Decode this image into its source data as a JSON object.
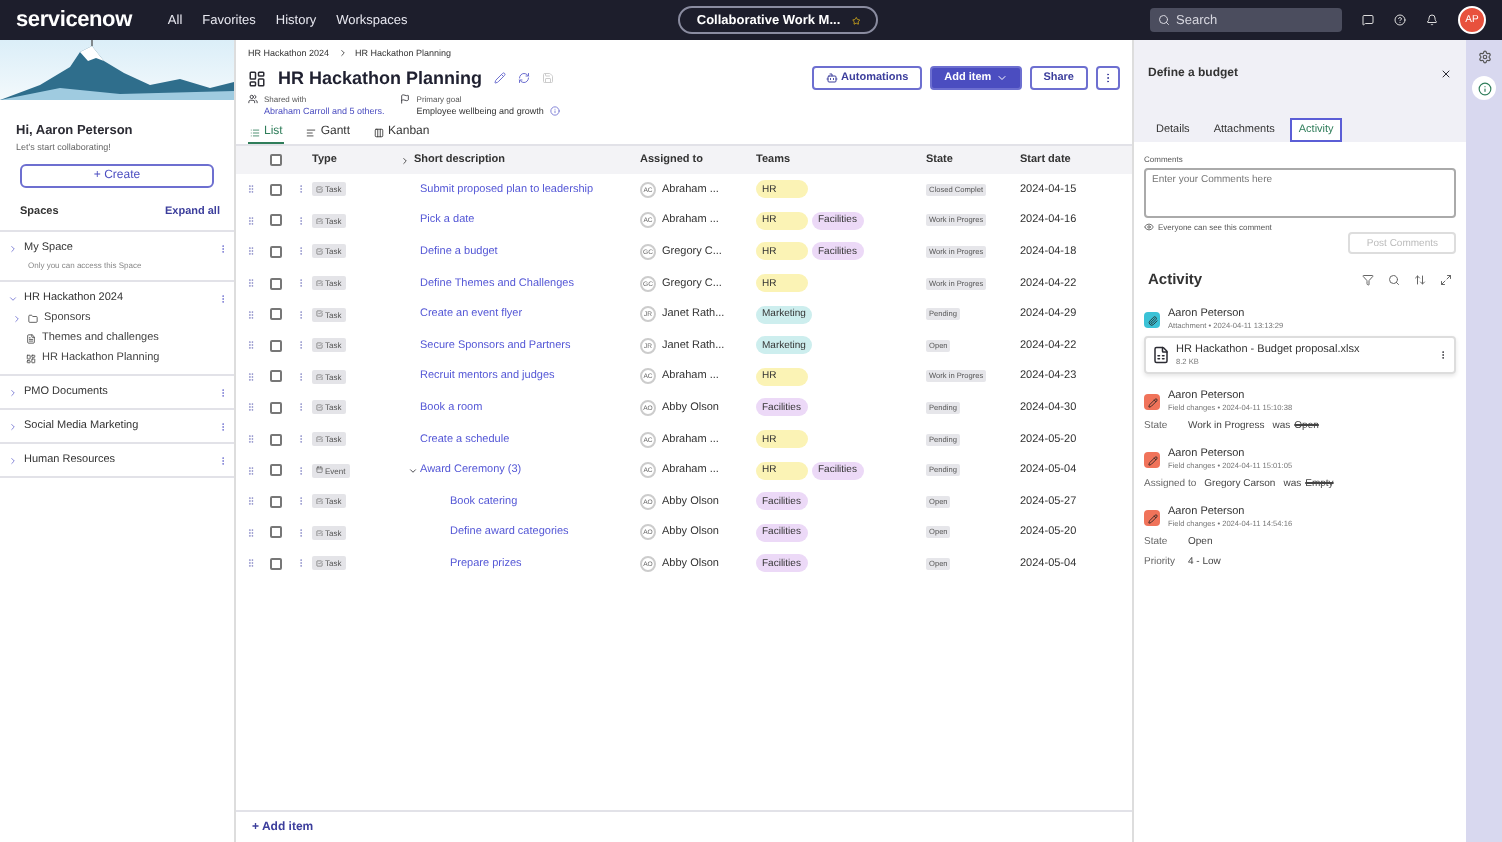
{
  "top_nav": {
    "logo": "servicenow",
    "menu": [
      "All",
      "Favorites",
      "History",
      "Workspaces"
    ],
    "workspace_pill": {
      "label": "Collaborative Work M...",
      "starred": false
    },
    "search": {
      "placeholder": "Search"
    },
    "avatar": "AP"
  },
  "sidebar": {
    "greeting": "Hi, Aaron Peterson",
    "subtitle": "Let's start collaborating!",
    "create_button": "+ Create",
    "spaces_label": "Spaces",
    "expand_all": "Expand all",
    "spaces": [
      {
        "name": "My Space",
        "note": "Only you can access this Space",
        "expanded": false
      },
      {
        "name": "HR Hackathon 2024",
        "expanded": true,
        "children": [
          {
            "kind": "folder",
            "label": "Sponsors"
          },
          {
            "kind": "document",
            "label": "Themes and challenges"
          },
          {
            "kind": "board",
            "label": "HR Hackathon Planning"
          }
        ]
      },
      {
        "name": "PMO Documents",
        "expanded": false
      },
      {
        "name": "Social Media Marketing",
        "expanded": false
      },
      {
        "name": "Human Resources",
        "expanded": false
      }
    ]
  },
  "main": {
    "breadcrumb": [
      "HR Hackathon 2024",
      "HR Hackathon Planning"
    ],
    "title": "HR Hackathon Planning",
    "shared_with": {
      "label": "Shared with",
      "value": "Abraham Carroll and 5 others."
    },
    "primary_goal": {
      "label": "Primary goal",
      "value": "Employee wellbeing and growth"
    },
    "buttons": {
      "automations": "Automations",
      "add_item": "Add item",
      "share": "Share"
    },
    "view_tabs": [
      {
        "label": "List",
        "selected": true
      },
      {
        "label": "Gantt",
        "selected": false
      },
      {
        "label": "Kanban",
        "selected": false
      }
    ],
    "table": {
      "columns": [
        "Type",
        "Short description",
        "Assigned to",
        "Teams",
        "State",
        "Start date"
      ],
      "select_all_checked": false,
      "rows": [
        {
          "checked": false,
          "type": {
            "kind": "task",
            "label": "Task"
          },
          "description": "Submit proposed plan to leadership",
          "assignee": {
            "initials": "AC",
            "name": "Abraham ..."
          },
          "teams": [
            {
              "label": "HR",
              "color": "#fbf3b5"
            }
          ],
          "state": "Closed Complet",
          "start_date": "2024-04-15"
        },
        {
          "checked": false,
          "type": {
            "kind": "task",
            "label": "Task"
          },
          "description": "Pick a date",
          "assignee": {
            "initials": "AC",
            "name": "Abraham ..."
          },
          "teams": [
            {
              "label": "HR",
              "color": "#fbf3b5"
            },
            {
              "label": "Facilities",
              "color": "#ecd9f7"
            }
          ],
          "state": "Work in Progres",
          "start_date": "2024-04-16"
        },
        {
          "checked": false,
          "type": {
            "kind": "task",
            "label": "Task"
          },
          "description": "Define a budget",
          "assignee": {
            "initials": "GC",
            "name": "Gregory C..."
          },
          "teams": [
            {
              "label": "HR",
              "color": "#fbf3b5"
            },
            {
              "label": "Facilities",
              "color": "#ecd9f7"
            }
          ],
          "state": "Work in Progres",
          "start_date": "2024-04-18"
        },
        {
          "checked": false,
          "type": {
            "kind": "task",
            "label": "Task"
          },
          "description": "Define Themes and Challenges",
          "assignee": {
            "initials": "GC",
            "name": "Gregory C..."
          },
          "teams": [
            {
              "label": "HR",
              "color": "#fbf3b5"
            }
          ],
          "state": "Work in Progres",
          "start_date": "2024-04-22"
        },
        {
          "checked": false,
          "type": {
            "kind": "task",
            "label": "Task"
          },
          "description": "Create an event flyer",
          "assignee": {
            "initials": "JR",
            "name": "Janet Rath..."
          },
          "teams": [
            {
              "label": "Marketing",
              "color": "#cdeeee"
            }
          ],
          "state": "Pending",
          "start_date": "2024-04-29"
        },
        {
          "checked": false,
          "type": {
            "kind": "task",
            "label": "Task"
          },
          "description": "Secure Sponsors and Partners",
          "assignee": {
            "initials": "JR",
            "name": "Janet Rath..."
          },
          "teams": [
            {
              "label": "Marketing",
              "color": "#cdeeee"
            }
          ],
          "state": "Open",
          "start_date": "2024-04-22"
        },
        {
          "checked": false,
          "type": {
            "kind": "task",
            "label": "Task"
          },
          "description": "Recruit mentors and judges",
          "assignee": {
            "initials": "AC",
            "name": "Abraham ..."
          },
          "teams": [
            {
              "label": "HR",
              "color": "#fbf3b5"
            }
          ],
          "state": "Work in Progres",
          "start_date": "2024-04-23"
        },
        {
          "checked": false,
          "type": {
            "kind": "task",
            "label": "Task"
          },
          "description": "Book a room",
          "assignee": {
            "initials": "AO",
            "name": "Abby Olson"
          },
          "teams": [
            {
              "label": "Facilities",
              "color": "#ecd9f7"
            }
          ],
          "state": "Pending",
          "start_date": "2024-04-30"
        },
        {
          "checked": false,
          "type": {
            "kind": "task",
            "label": "Task"
          },
          "description": "Create a schedule",
          "assignee": {
            "initials": "AC",
            "name": "Abraham ..."
          },
          "teams": [
            {
              "label": "HR",
              "color": "#fbf3b5"
            }
          ],
          "state": "Pending",
          "start_date": "2024-05-20"
        },
        {
          "checked": false,
          "type": {
            "kind": "event",
            "label": "Event"
          },
          "description": "Award Ceremony (3)",
          "assignee": {
            "initials": "AC",
            "name": "Abraham ..."
          },
          "teams": [
            {
              "label": "HR",
              "color": "#fbf3b5"
            },
            {
              "label": "Facilities",
              "color": "#ecd9f7"
            }
          ],
          "state": "Pending",
          "start_date": "2024-05-04",
          "expanded": true,
          "children": [
            {
              "checked": false,
              "type": {
                "kind": "task",
                "label": "Task"
              },
              "description": "Book catering",
              "assignee": {
                "initials": "AO",
                "name": "Abby Olson"
              },
              "teams": [
                {
                  "label": "Facilities",
                  "color": "#ecd9f7"
                }
              ],
              "state": "Open",
              "start_date": "2024-05-27"
            },
            {
              "checked": false,
              "type": {
                "kind": "task",
                "label": "Task"
              },
              "description": "Define award categories",
              "assignee": {
                "initials": "AO",
                "name": "Abby Olson"
              },
              "teams": [
                {
                  "label": "Facilities",
                  "color": "#ecd9f7"
                }
              ],
              "state": "Open",
              "start_date": "2024-05-20"
            },
            {
              "checked": false,
              "type": {
                "kind": "task",
                "label": "Task"
              },
              "description": "Prepare prizes",
              "assignee": {
                "initials": "AO",
                "name": "Abby Olson"
              },
              "teams": [
                {
                  "label": "Facilities",
                  "color": "#ecd9f7"
                }
              ],
              "state": "Open",
              "start_date": "2024-05-04"
            }
          ]
        }
      ]
    },
    "add_item_footer": "+ Add item"
  },
  "detail_panel": {
    "title": "Define a budget",
    "tabs": [
      {
        "label": "Details",
        "selected": false
      },
      {
        "label": "Attachments",
        "selected": false
      },
      {
        "label": "Activity",
        "selected": true
      }
    ],
    "comments_label": "Comments",
    "comments_placeholder": "Enter your Comments here",
    "visibility_note": "Everyone can see this comment",
    "post_button": {
      "label": "Post Comments",
      "disabled": true
    },
    "activity_title": "Activity",
    "entries": [
      {
        "kind": "attachment",
        "author": "Aaron Peterson",
        "meta": "Attachment • 2024-04-11 13:13:29",
        "file": {
          "name": "HR Hackathon - Budget proposal.xlsx",
          "size": "8.2 KB"
        }
      },
      {
        "kind": "field_change",
        "author": "Aaron Peterson",
        "meta": "Field changes • 2024-04-11 15:10:38",
        "changes": [
          {
            "field": "State",
            "value": "Work in Progress",
            "was": "was",
            "old": "Open"
          }
        ]
      },
      {
        "kind": "field_change",
        "author": "Aaron Peterson",
        "meta": "Field changes • 2024-04-11 15:01:05",
        "changes": [
          {
            "field": "Assigned to",
            "value": "Gregory Carson",
            "was": "was",
            "old": "Empty"
          }
        ]
      },
      {
        "kind": "field_change",
        "author": "Aaron Peterson",
        "meta": "Field changes • 2024-04-11 14:54:16",
        "changes": [
          {
            "field": "State",
            "value": "Open"
          },
          {
            "field": "Priority",
            "value": "4 - Low"
          }
        ]
      }
    ]
  }
}
